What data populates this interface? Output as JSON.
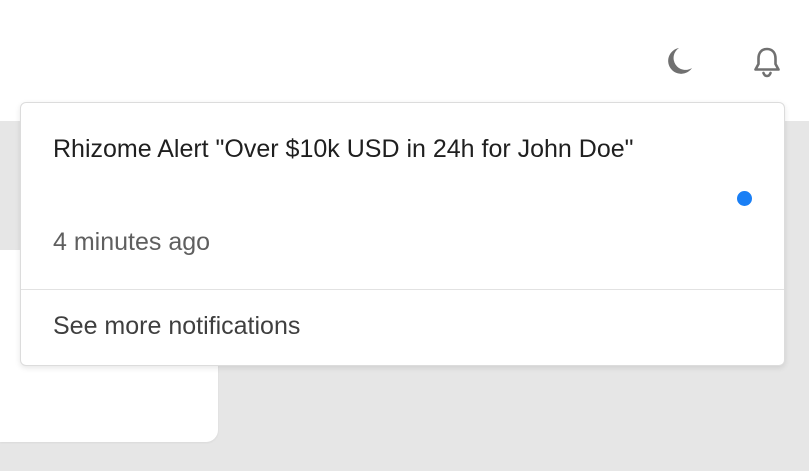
{
  "header": {
    "theme_toggle_icon": "moon-icon",
    "notifications_icon": "bell-icon"
  },
  "notifications": {
    "items": [
      {
        "title": "Rhizome Alert \"Over $10k USD in 24h for John Doe\"",
        "time": "4 minutes ago",
        "unread": true
      }
    ],
    "see_more_label": "See more notifications"
  },
  "colors": {
    "unread_dot": "#1a7ff5",
    "icon": "#707070",
    "backdrop": "#e6e6e6"
  }
}
